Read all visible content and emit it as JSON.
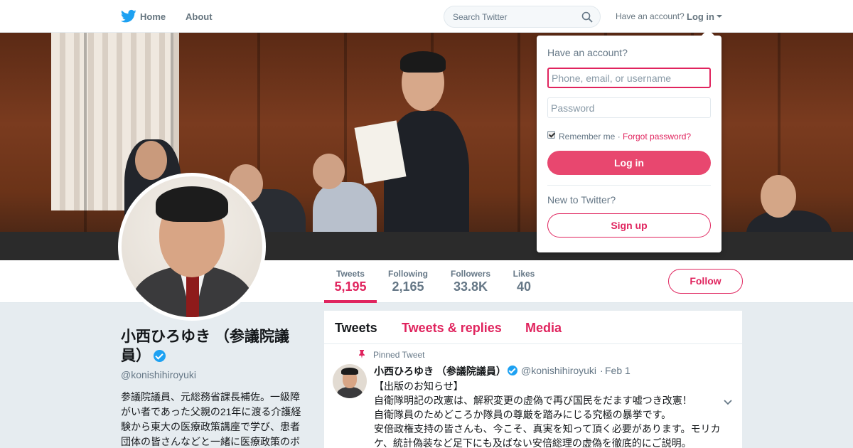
{
  "nav": {
    "home_label": "Home",
    "about_label": "About",
    "search_placeholder": "Search Twitter",
    "have_account_label": "Have an account?",
    "login_label": "Log in"
  },
  "profile_nav": {
    "stats": [
      {
        "label": "Tweets",
        "value": "5,195"
      },
      {
        "label": "Following",
        "value": "2,165"
      },
      {
        "label": "Followers",
        "value": "33.8K"
      },
      {
        "label": "Likes",
        "value": "40"
      }
    ],
    "follow_label": "Follow"
  },
  "profile": {
    "name": "小西ひろゆき （参議院議員）",
    "handle": "@konishihiroyuki",
    "bio": "参議院議員、元総務省課長補佐。一級障がい者であった父親の21年に渡る介護経験から東大の医療政策講座で学び、患者団体の皆さんなどと一緒に医療政策のボ"
  },
  "timeline": {
    "tabs": {
      "tweets": "Tweets",
      "replies": "Tweets & replies",
      "media": "Media"
    },
    "tweet": {
      "pinned_label": "Pinned Tweet",
      "author_name": "小西ひろゆき （参議院議員）",
      "author_handle": "@konishihiroyuki",
      "separator": "·",
      "date": "Feb 1",
      "lines": [
        "【出版のお知らせ】",
        "自衛隊明記の改憲は、解釈変更の虚偽で再び国民をだます嘘つき改憲！",
        "自衛隊員のためどころか隊員の尊厳を踏みにじる究極の暴挙です。",
        "安倍政権支持の皆さんも、今こそ、真実を知って頂く必要があります。モリカ",
        "ケ、統計偽装など足下にも及ばない安倍総理の虚偽を徹底的にご説明。"
      ]
    }
  },
  "login_dropdown": {
    "title": "Have an account?",
    "username_placeholder": "Phone, email, or username",
    "password_placeholder": "Password",
    "remember_label": "Remember me",
    "separator": "·",
    "forgot_label": "Forgot password?",
    "login_button": "Log in",
    "new_label": "New to Twitter?",
    "signup_button": "Sign up"
  },
  "colors": {
    "accent": "#e0245e",
    "twitter_blue": "#1da1f2",
    "muted": "#657786"
  }
}
